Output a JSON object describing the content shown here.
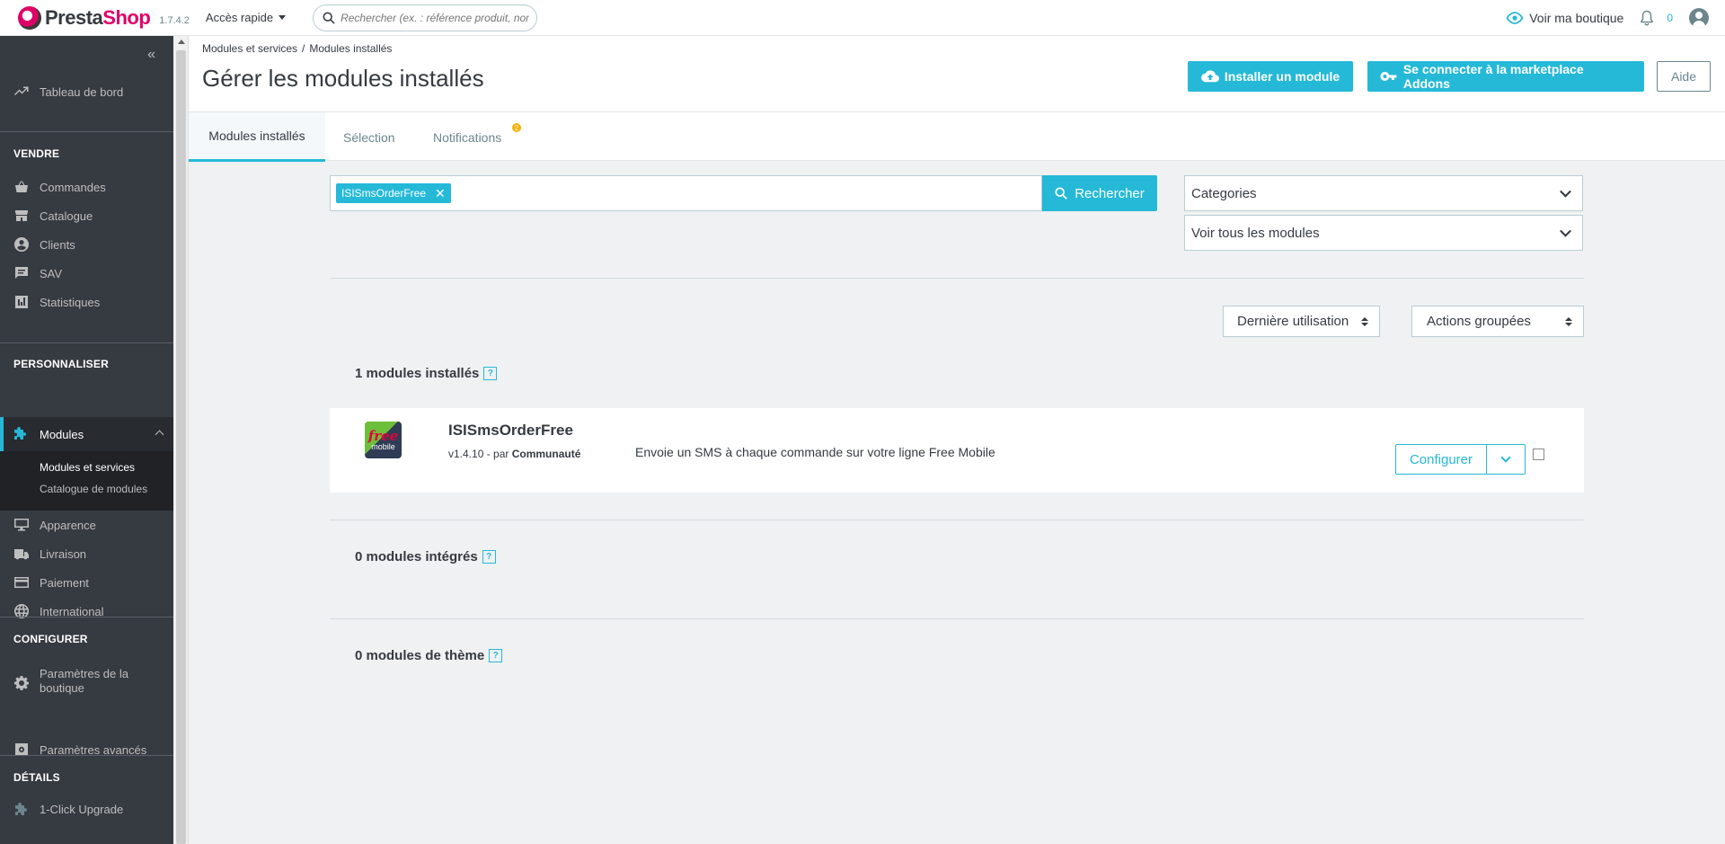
{
  "header": {
    "logo_presta": "Presta",
    "logo_shop": "Shop",
    "version": "1.7.4.2",
    "quick_access": "Accès rapide",
    "search_placeholder": "Rechercher (ex. : référence produit, nom",
    "view_shop": "Voir ma boutique",
    "notif_count": "0"
  },
  "sidebar": {
    "collapse": "«",
    "dashboard": "Tableau de bord",
    "sections": {
      "sell": "VENDRE",
      "customize": "PERSONNALISER",
      "configure": "CONFIGURER",
      "details": "DÉTAILS"
    },
    "sell_items": [
      "Commandes",
      "Catalogue",
      "Clients",
      "SAV",
      "Statistiques"
    ],
    "modules": "Modules",
    "modules_sub": [
      "Modules et services",
      "Catalogue de modules"
    ],
    "customize_items": [
      "Apparence",
      "Livraison",
      "Paiement",
      "International"
    ],
    "configure_items": [
      "Paramètres de la boutique",
      "Paramètres avancés"
    ],
    "details_items": [
      "1-Click Upgrade"
    ]
  },
  "page": {
    "breadcrumb": [
      "Modules et services",
      "Modules installés"
    ],
    "breadcrumb_sep": "/",
    "title": "Gérer les modules installés",
    "btn_install": "Installer un module",
    "btn_addons": "Se connecter à la marketplace Addons",
    "btn_help": "Aide"
  },
  "tabs": [
    {
      "label": "Modules installés",
      "active": true
    },
    {
      "label": "Sélection",
      "active": false
    },
    {
      "label": "Notifications",
      "active": false,
      "badge": "2"
    }
  ],
  "filters": {
    "search_tag": "ISISmsOrderFree",
    "search_btn": "Rechercher",
    "categories": "Categories",
    "status": "Voir tous les modules",
    "sort": "Dernière utilisation",
    "bulk": "Actions groupées"
  },
  "sections": {
    "installed": "1 modules installés",
    "integrated": "0 modules intégrés",
    "theme": "0 modules de thème",
    "help_mark": "?"
  },
  "module": {
    "logo_top": "free",
    "logo_bottom": "mobile",
    "name": "ISISmsOrderFree",
    "version_prefix": "v1.4.10 - par",
    "author": "Communauté",
    "description": "Envoie un SMS à  chaque commande sur votre ligne Free Mobile",
    "configure": "Configurer"
  }
}
